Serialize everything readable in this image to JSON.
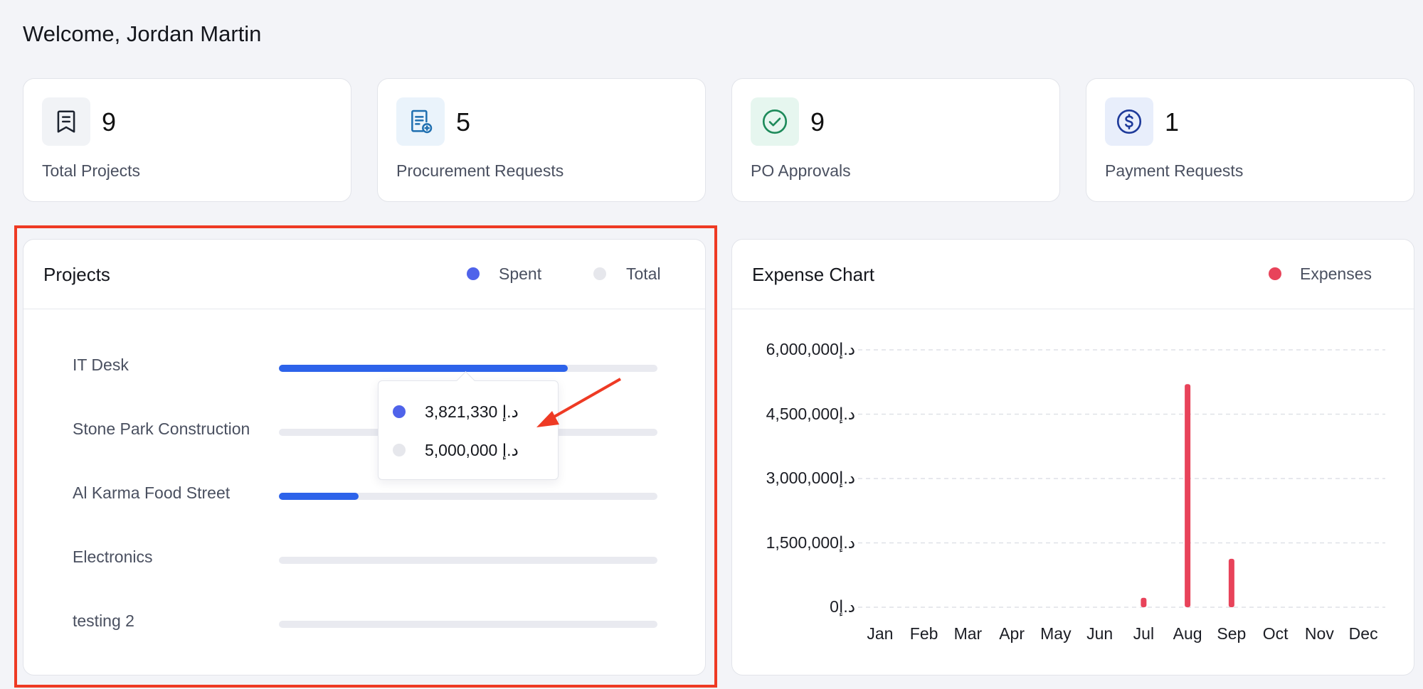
{
  "header": {
    "welcome": "Welcome, Jordan Martin"
  },
  "stats": [
    {
      "value": "9",
      "label": "Total Projects",
      "icon": "receipt-icon",
      "icon_bg": "#f1f3f6",
      "icon_color": "#1d2430"
    },
    {
      "value": "5",
      "label": "Procurement Requests",
      "icon": "document-add-icon",
      "icon_bg": "#eaf3fb",
      "icon_color": "#1f6fb0"
    },
    {
      "value": "9",
      "label": "PO Approvals",
      "icon": "check-circle-icon",
      "icon_bg": "#e6f6ef",
      "icon_color": "#1d8a5a"
    },
    {
      "value": "1",
      "label": "Payment Requests",
      "icon": "dollar-circle-icon",
      "icon_bg": "#e8eefb",
      "icon_color": "#1e3a9a"
    }
  ],
  "projects": {
    "title": "Projects",
    "legend": [
      {
        "label": "Spent",
        "color": "#4f63ea"
      },
      {
        "label": "Total",
        "color": "#e6e7ec"
      }
    ],
    "rows": [
      {
        "name": "IT Desk",
        "spent_fraction": 0.764
      },
      {
        "name": "Stone Park Construction",
        "spent_fraction": 0
      },
      {
        "name": "Al Karma Food Street",
        "spent_fraction": 0.21
      },
      {
        "name": "Electronics",
        "spent_fraction": 0
      },
      {
        "name": "testing 2",
        "spent_fraction": 0
      }
    ],
    "tooltip": {
      "spent": "3,821,330 د.إ",
      "total": "5,000,000 د.إ"
    }
  },
  "expense": {
    "title": "Expense Chart",
    "legend_label": "Expenses",
    "color": "#e8435a"
  },
  "chart_data": {
    "type": "bar",
    "title": "Expense Chart",
    "categories": [
      "Jan",
      "Feb",
      "Mar",
      "Apr",
      "May",
      "Jun",
      "Jul",
      "Aug",
      "Sep",
      "Oct",
      "Nov",
      "Dec"
    ],
    "series": [
      {
        "name": "Expenses",
        "values": [
          0,
          0,
          0,
          0,
          0,
          0,
          220000,
          5200000,
          1130000,
          0,
          0,
          0
        ]
      }
    ],
    "ylim": [
      0,
      6000000
    ],
    "yticks": [
      "6,000,000د.إ",
      "4,500,000د.إ",
      "3,000,000د.إ",
      "1,500,000د.إ",
      "0د.إ"
    ],
    "ytick_values": [
      6000000,
      4500000,
      3000000,
      1500000,
      0
    ],
    "legend": "top-right",
    "grid": true
  }
}
